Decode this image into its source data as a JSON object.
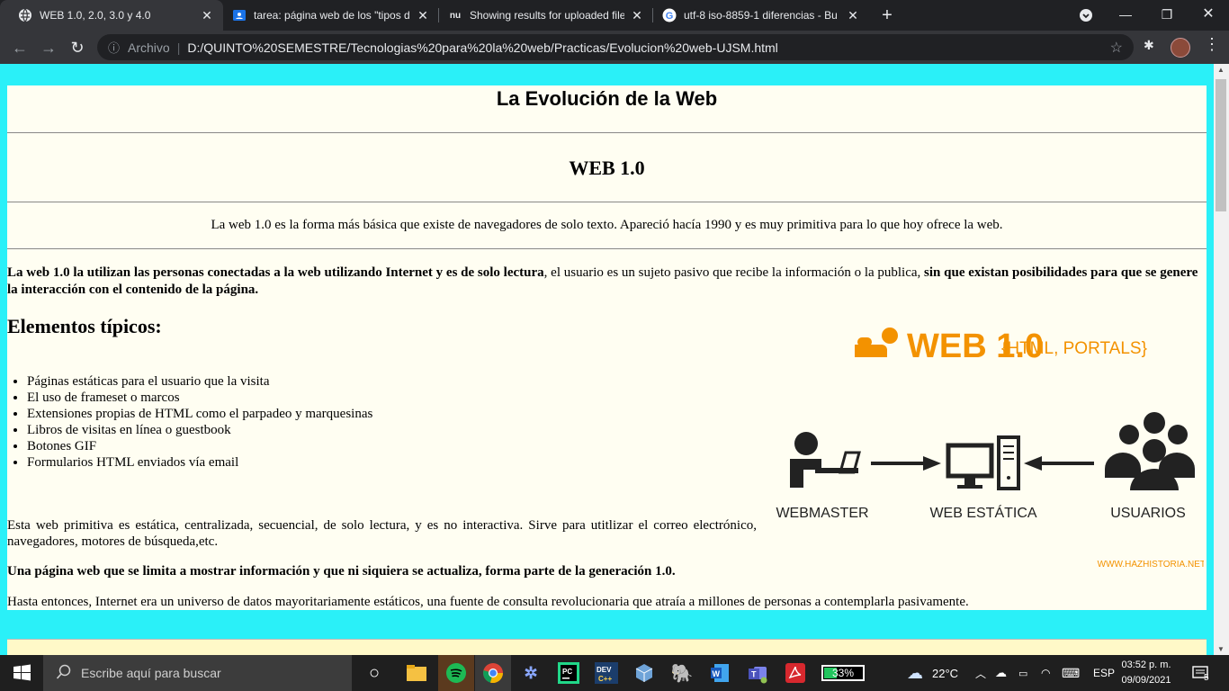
{
  "browser": {
    "tabs": [
      {
        "title": "WEB 1.0, 2.0, 3.0 y 4.0",
        "icon": "globe-icon",
        "active": true
      },
      {
        "title": "tarea: página web de los \"tipos d",
        "icon": "classroom-icon",
        "active": false
      },
      {
        "title": "Showing results for uploaded file",
        "icon": "nu-icon",
        "active": false
      },
      {
        "title": "utf-8 iso-8859-1 diferencias - Bu",
        "icon": "google-icon",
        "active": false
      }
    ],
    "address": {
      "scheme_label": "Archivo",
      "url": "D:/QUINTO%20SEMESTRE/Tecnologias%20para%20la%20web/Practicas/Evolucion%20web-UJSM.html"
    }
  },
  "page": {
    "title": "La Evolución de la Web",
    "section_heading": "WEB 1.0",
    "intro": "La web 1.0 es la forma más básica que existe de navegadores de solo texto. Apareció hacía 1990 y es muy primitiva para lo que hoy ofrece la web.",
    "p1_bold1": "La web 1.0 la utilizan las personas conectadas a la web utilizando Internet y es de solo lectura",
    "p1_normal": ", el usuario es un sujeto pasivo que recibe la información o la publica, ",
    "p1_bold2": "sin que existan posibilidades para que se genere la interacción con el contenido de la página.",
    "elements_heading": "Elementos típicos:",
    "elements": [
      "Páginas estáticas para el usuario que la visita",
      "El uso de frameset o marcos",
      "Extensiones propias de HTML como el parpadeo y marquesinas",
      "Libros de visitas en línea o guestbook",
      "Botones GIF",
      "Formularios HTML enviados vía email"
    ],
    "p2": "Esta web primitiva es estática, centralizada, secuencial, de solo lectura, y es no interactiva. Sirve para utitlizar el correo electrónico, navegadores, motores de búsqueda,etc.",
    "p3": "Una página web que se limita a mostrar información y que ni siquiera se actualiza, forma parte de la generación 1.0.",
    "p4": "Hasta entonces, Internet era un universo de datos mayoritariamente estáticos, una fuente de consulta revolucionaria que atraía a millones de personas a contemplarla pasivamente.",
    "figure": {
      "heading_main": "WEB 1.0",
      "heading_sub": "{HTML, PORTALS}",
      "label_webmaster": "WEBMASTER",
      "label_static": "WEB ESTÁTICA",
      "label_users": "USUARIOS",
      "credit": "WWW.HAZHISTORIA.NET",
      "accent_color": "#f39200"
    }
  },
  "taskbar": {
    "search_placeholder": "Escribe aquí para buscar",
    "battery": "33%",
    "weather": "22°C",
    "language": "ESP",
    "time": "03:52 p. m.",
    "date": "09/09/2021",
    "notifications": "5"
  }
}
